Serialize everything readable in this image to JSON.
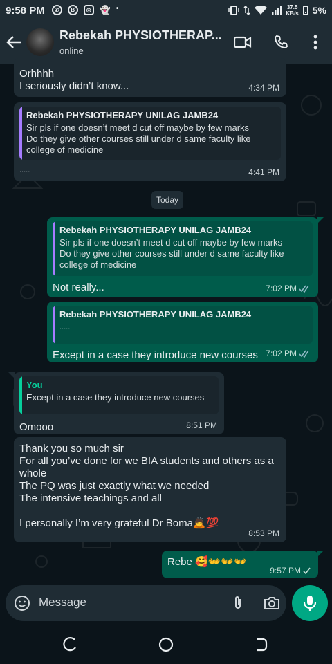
{
  "status_bar": {
    "time": "9:58 PM",
    "speed_value": "37.5",
    "speed_unit": "KB/s",
    "battery": "5%"
  },
  "header": {
    "contact_name": "Rebekah PHYSIOTHERAP...",
    "status": "online"
  },
  "messages": [
    {
      "id": "m1",
      "direction": "in",
      "text": "Orhhhh\nI seriously didn’t know...",
      "time": "4:34 PM"
    },
    {
      "id": "m2",
      "direction": "in",
      "quote": {
        "author": "Rebekah PHYSIOTHERAPY UNILAG JAMB24",
        "text": "Sir pls if one doesn’t meet d cut off maybe by few marks\nDo they give other courses still under d same faculty like\ncollege of medicine"
      },
      "text": ".....",
      "time": "4:41 PM"
    },
    {
      "id": "m3",
      "direction": "out",
      "quote": {
        "author": "Rebekah PHYSIOTHERAPY UNILAG JAMB24",
        "text": "Sir pls if one doesn’t meet d cut off maybe by few marks\nDo they give other courses still under d same faculty like\ncollege of medicine"
      },
      "text": "Not really...",
      "time": "7:02 PM",
      "status": "read"
    },
    {
      "id": "m4",
      "direction": "out",
      "quote": {
        "author": "Rebekah PHYSIOTHERAPY UNILAG JAMB24",
        "text": "....."
      },
      "text": "Except in a case they introduce new courses",
      "time": "7:02 PM",
      "status": "read"
    },
    {
      "id": "m5",
      "direction": "in",
      "quote": {
        "author": "You",
        "text": "Except in a case they introduce new courses"
      },
      "text": "Omooo",
      "time": "8:51 PM"
    },
    {
      "id": "m6",
      "direction": "in",
      "text": "Thank you so much sir\nFor all you’ve done for we BIA students and others as a\nwhole\nThe PQ was just exactly what we needed\nThe intensive teachings and all\n\nI personally I’m very grateful Dr Boma🙇💯",
      "time": "8:53 PM"
    },
    {
      "id": "m7",
      "direction": "out",
      "text": "Rebe 🥰👐👐👐",
      "time": "9:57 PM",
      "status": "delivered"
    }
  ],
  "day_divider": "Today",
  "composer": {
    "placeholder": "Message"
  },
  "colors": {
    "background": "#0b141a",
    "incoming_bubble": "#1f2c34",
    "outgoing_bubble": "#005c4b",
    "accent": "#00a884",
    "read_tick": "#53bdeb"
  },
  "icons": {
    "header": [
      "back-arrow-icon",
      "video-call-icon",
      "voice-call-icon",
      "more-options-icon"
    ],
    "composer": [
      "emoji-icon",
      "attach-icon",
      "camera-icon",
      "mic-icon"
    ],
    "navbar": [
      "recents-icon",
      "home-icon",
      "back-icon"
    ]
  }
}
